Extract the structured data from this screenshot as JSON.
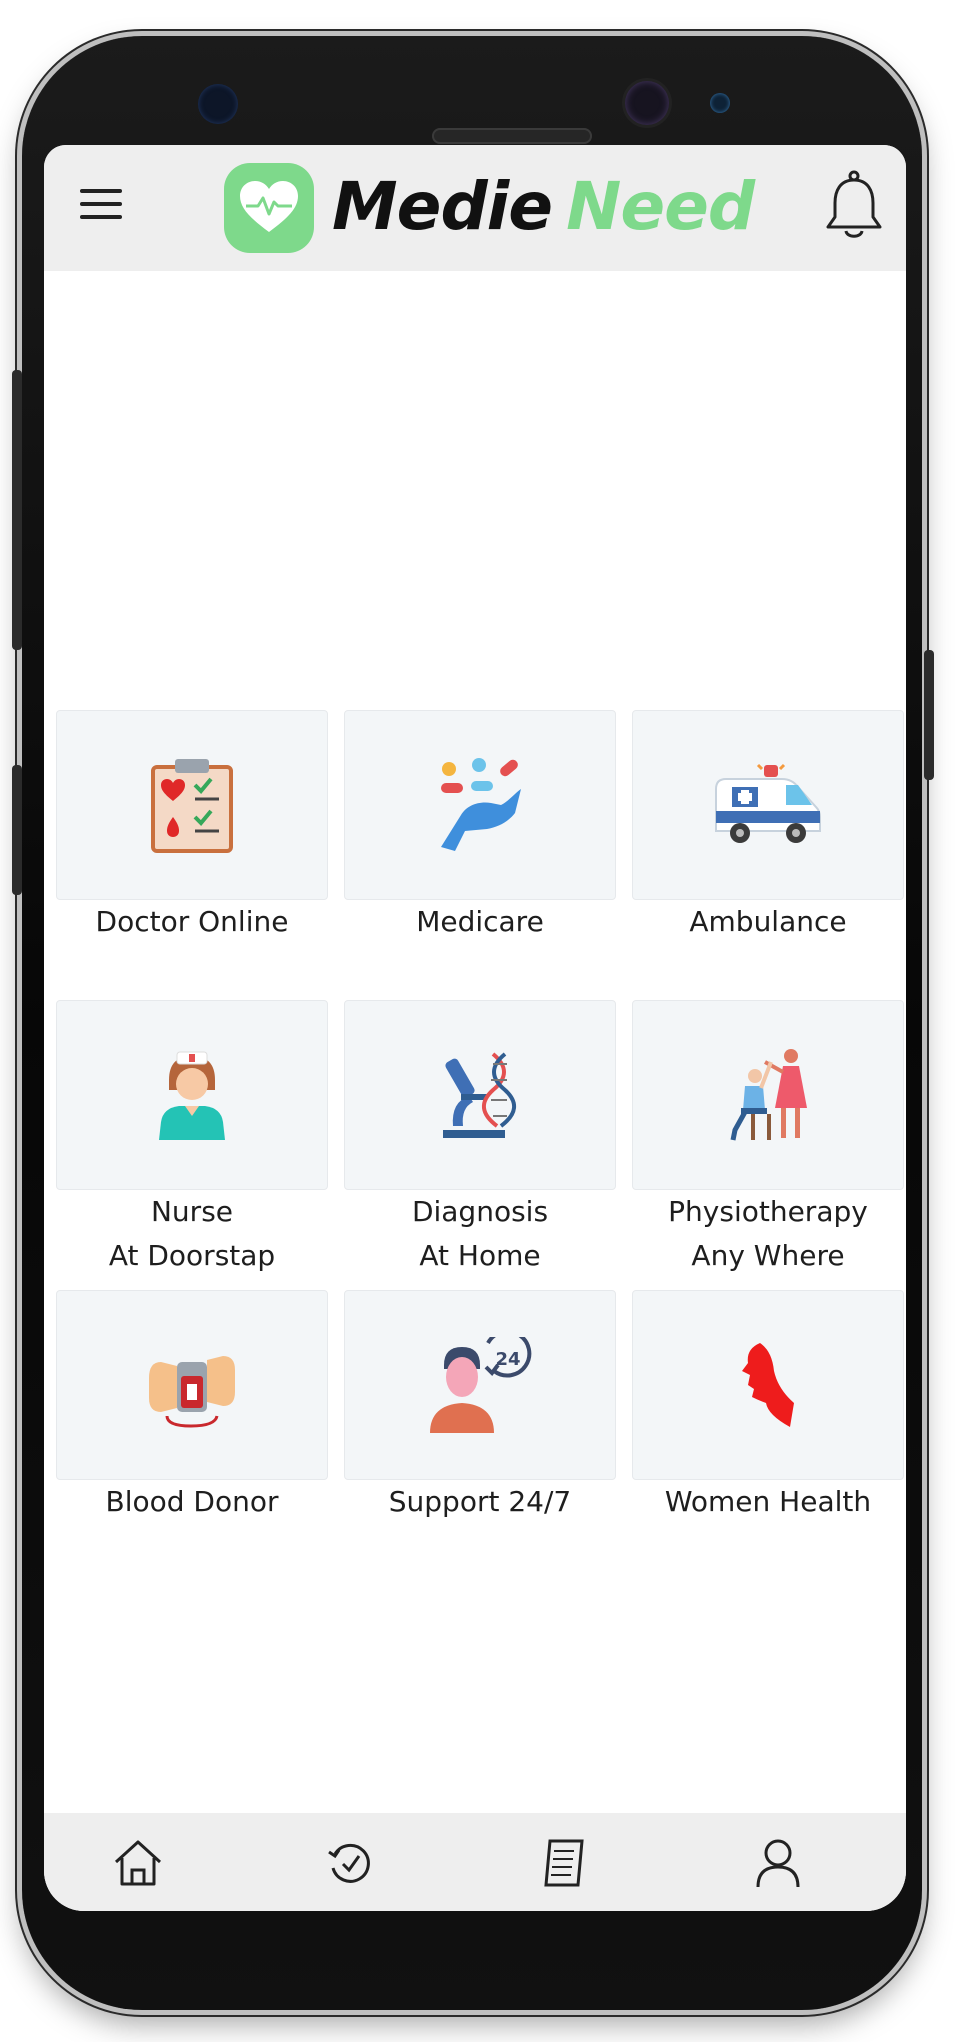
{
  "app": {
    "brand_part1": "Medie",
    "brand_part2": "Need"
  },
  "colors": {
    "brand_green": "#7ed98b",
    "bar_background": "#eeeeee",
    "card_background": "#f3f6f8"
  },
  "header": {
    "menu_icon": "hamburger-menu-icon",
    "logo_icon": "heart-pulse-icon",
    "notification_icon": "bell-icon"
  },
  "services": [
    {
      "label": "Doctor Online",
      "icon": "clipboard-checklist-icon"
    },
    {
      "label": "Medicare",
      "icon": "hand-pills-icon"
    },
    {
      "label": "Ambulance",
      "icon": "ambulance-icon"
    },
    {
      "label": "Nurse\nAt Doorstap",
      "icon": "nurse-icon"
    },
    {
      "label": "Diagnosis\nAt Home",
      "icon": "microscope-dna-icon"
    },
    {
      "label": "Physiotherapy\nAny Where",
      "icon": "physiotherapy-icon"
    },
    {
      "label": "Blood Donor",
      "icon": "blood-bag-icon"
    },
    {
      "label": "Support 24/7",
      "icon": "support-24-icon"
    },
    {
      "label": "Women Health",
      "icon": "woman-profile-icon"
    }
  ],
  "bottom_nav": [
    {
      "icon": "home-icon"
    },
    {
      "icon": "history-icon"
    },
    {
      "icon": "reports-icon"
    },
    {
      "icon": "profile-icon"
    }
  ]
}
